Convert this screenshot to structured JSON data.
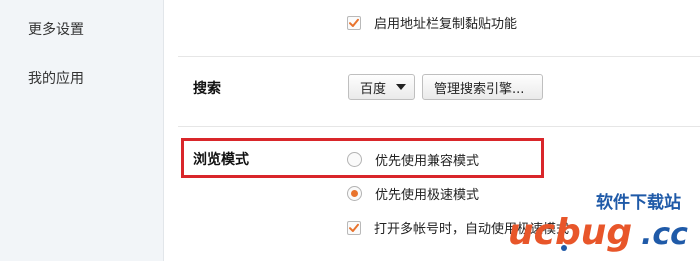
{
  "sidebar": {
    "items": [
      {
        "label": "更多设置"
      },
      {
        "label": "我的应用"
      }
    ]
  },
  "address_bar": {
    "paste_option": {
      "label": "启用地址栏复制黏贴功能",
      "checked": true
    }
  },
  "search": {
    "title": "搜索",
    "engine_dropdown": {
      "value": "百度"
    },
    "manage_button": {
      "label": "管理搜索引擎..."
    }
  },
  "browse_mode": {
    "title": "浏览模式",
    "options": [
      {
        "label": "优先使用兼容模式",
        "selected": false
      },
      {
        "label": "优先使用极速模式",
        "selected": true
      }
    ],
    "multi_account_option": {
      "label": "打开多帐号时，自动使用极速模式",
      "checked": true
    }
  },
  "watermark": {
    "top_text": "软件下载站",
    "logo_text": "ucbug",
    "suffix": ".cc"
  },
  "colors": {
    "accent_orange": "#e8732d",
    "highlight_red": "#d9262a",
    "sidebar_bg": "#f2f5f8"
  }
}
